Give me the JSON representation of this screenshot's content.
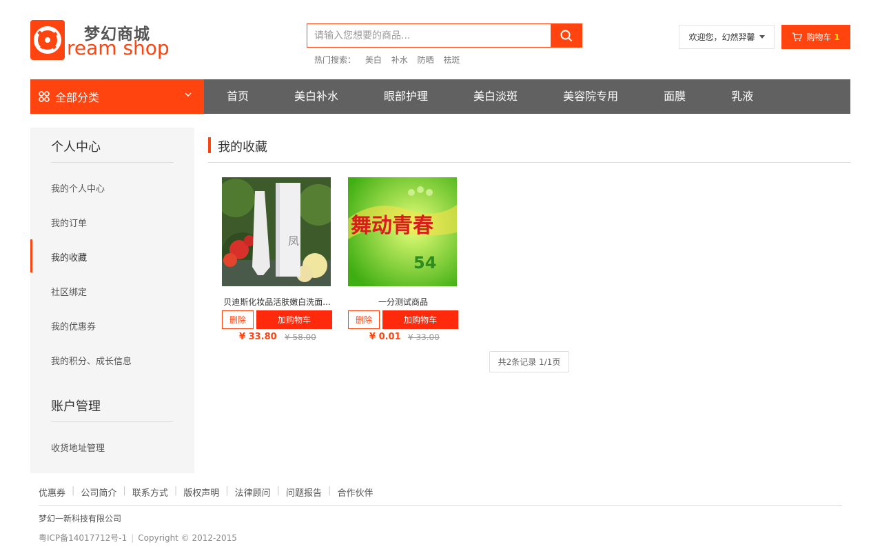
{
  "header": {
    "logo_cn": "梦幻商城",
    "logo_en": "ream shop",
    "search_placeholder": "请输入您想要的商品...",
    "hot_label": "热门搜索：",
    "hot_terms": [
      "美白",
      "补水",
      "防晒",
      "祛斑"
    ],
    "welcome": "欢迎您，幻然羿馨",
    "cart_label": "购物车",
    "cart_count": "1"
  },
  "nav": {
    "category_label": "全部分类",
    "items": [
      "首页",
      "美白补水",
      "眼部护理",
      "美白淡斑",
      "美容院专用",
      "面膜",
      "乳液"
    ]
  },
  "sidebar": {
    "section1_title": "个人中心",
    "section1_items": [
      "我的个人中心",
      "我的订单",
      "我的收藏",
      "社区绑定",
      "我的优惠券",
      "我的积分、成长信息"
    ],
    "section2_title": "账户管理",
    "section2_items": [
      "收货地址管理"
    ],
    "active_item": "我的收藏"
  },
  "main": {
    "title": "我的收藏",
    "delete_label": "删除",
    "add_cart_label": "加购物车",
    "products": [
      {
        "name": "贝迪斯化妆品活肤嫩白洗面...",
        "price": "¥ 33.80",
        "old_price": "¥ 58.00"
      },
      {
        "name": "一分测试商品",
        "price": "¥ 0.01",
        "old_price": "¥ 33.00"
      }
    ],
    "pager": "共2条记录 1/1页"
  },
  "footer": {
    "links": [
      "优惠券",
      "公司简介",
      "联系方式",
      "版权声明",
      "法律顾问",
      "问题报告",
      "合作伙伴"
    ],
    "company": "梦幻一新科技有限公司",
    "icp": "粤ICP备14017712号-1",
    "copyright": "Copyright © 2012-2015"
  },
  "colors": {
    "accent": "#ff4410",
    "nav_bg": "#616161",
    "sidebar_bg": "#f5f5f5"
  }
}
